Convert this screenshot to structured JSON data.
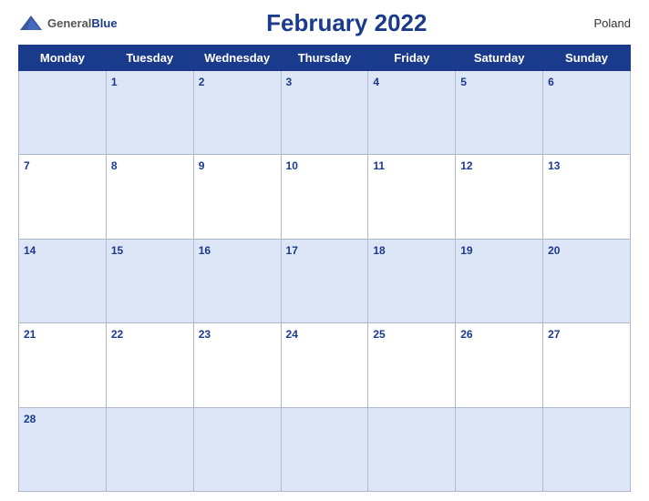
{
  "header": {
    "logo_general": "General",
    "logo_blue": "Blue",
    "title": "February 2022",
    "country": "Poland"
  },
  "days_of_week": [
    "Monday",
    "Tuesday",
    "Wednesday",
    "Thursday",
    "Friday",
    "Saturday",
    "Sunday"
  ],
  "weeks": [
    [
      null,
      1,
      2,
      3,
      4,
      5,
      6
    ],
    [
      7,
      8,
      9,
      10,
      11,
      12,
      13
    ],
    [
      14,
      15,
      16,
      17,
      18,
      19,
      20
    ],
    [
      21,
      22,
      23,
      24,
      25,
      26,
      27
    ],
    [
      28,
      null,
      null,
      null,
      null,
      null,
      null
    ]
  ]
}
